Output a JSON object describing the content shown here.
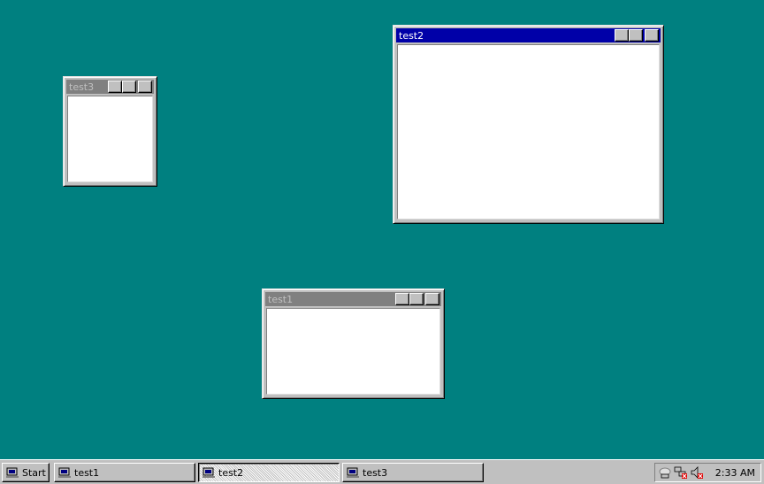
{
  "windows": {
    "test1": {
      "title": "test1",
      "active": false
    },
    "test2": {
      "title": "test2",
      "active": true
    },
    "test3": {
      "title": "test3",
      "active": false
    }
  },
  "taskbar": {
    "start_label": "Start",
    "buttons": [
      {
        "label": "test1",
        "pressed": false
      },
      {
        "label": "test2",
        "pressed": true
      },
      {
        "label": "test3",
        "pressed": false
      }
    ],
    "tray": {
      "icons": [
        "network-cloud-icon",
        "network-disconnected-icon",
        "volume-muted-icon"
      ],
      "clock": "2:33 AM"
    }
  },
  "colors": {
    "desktop": "#008080",
    "active_title": "#0000a8",
    "inactive_title": "#808080"
  }
}
